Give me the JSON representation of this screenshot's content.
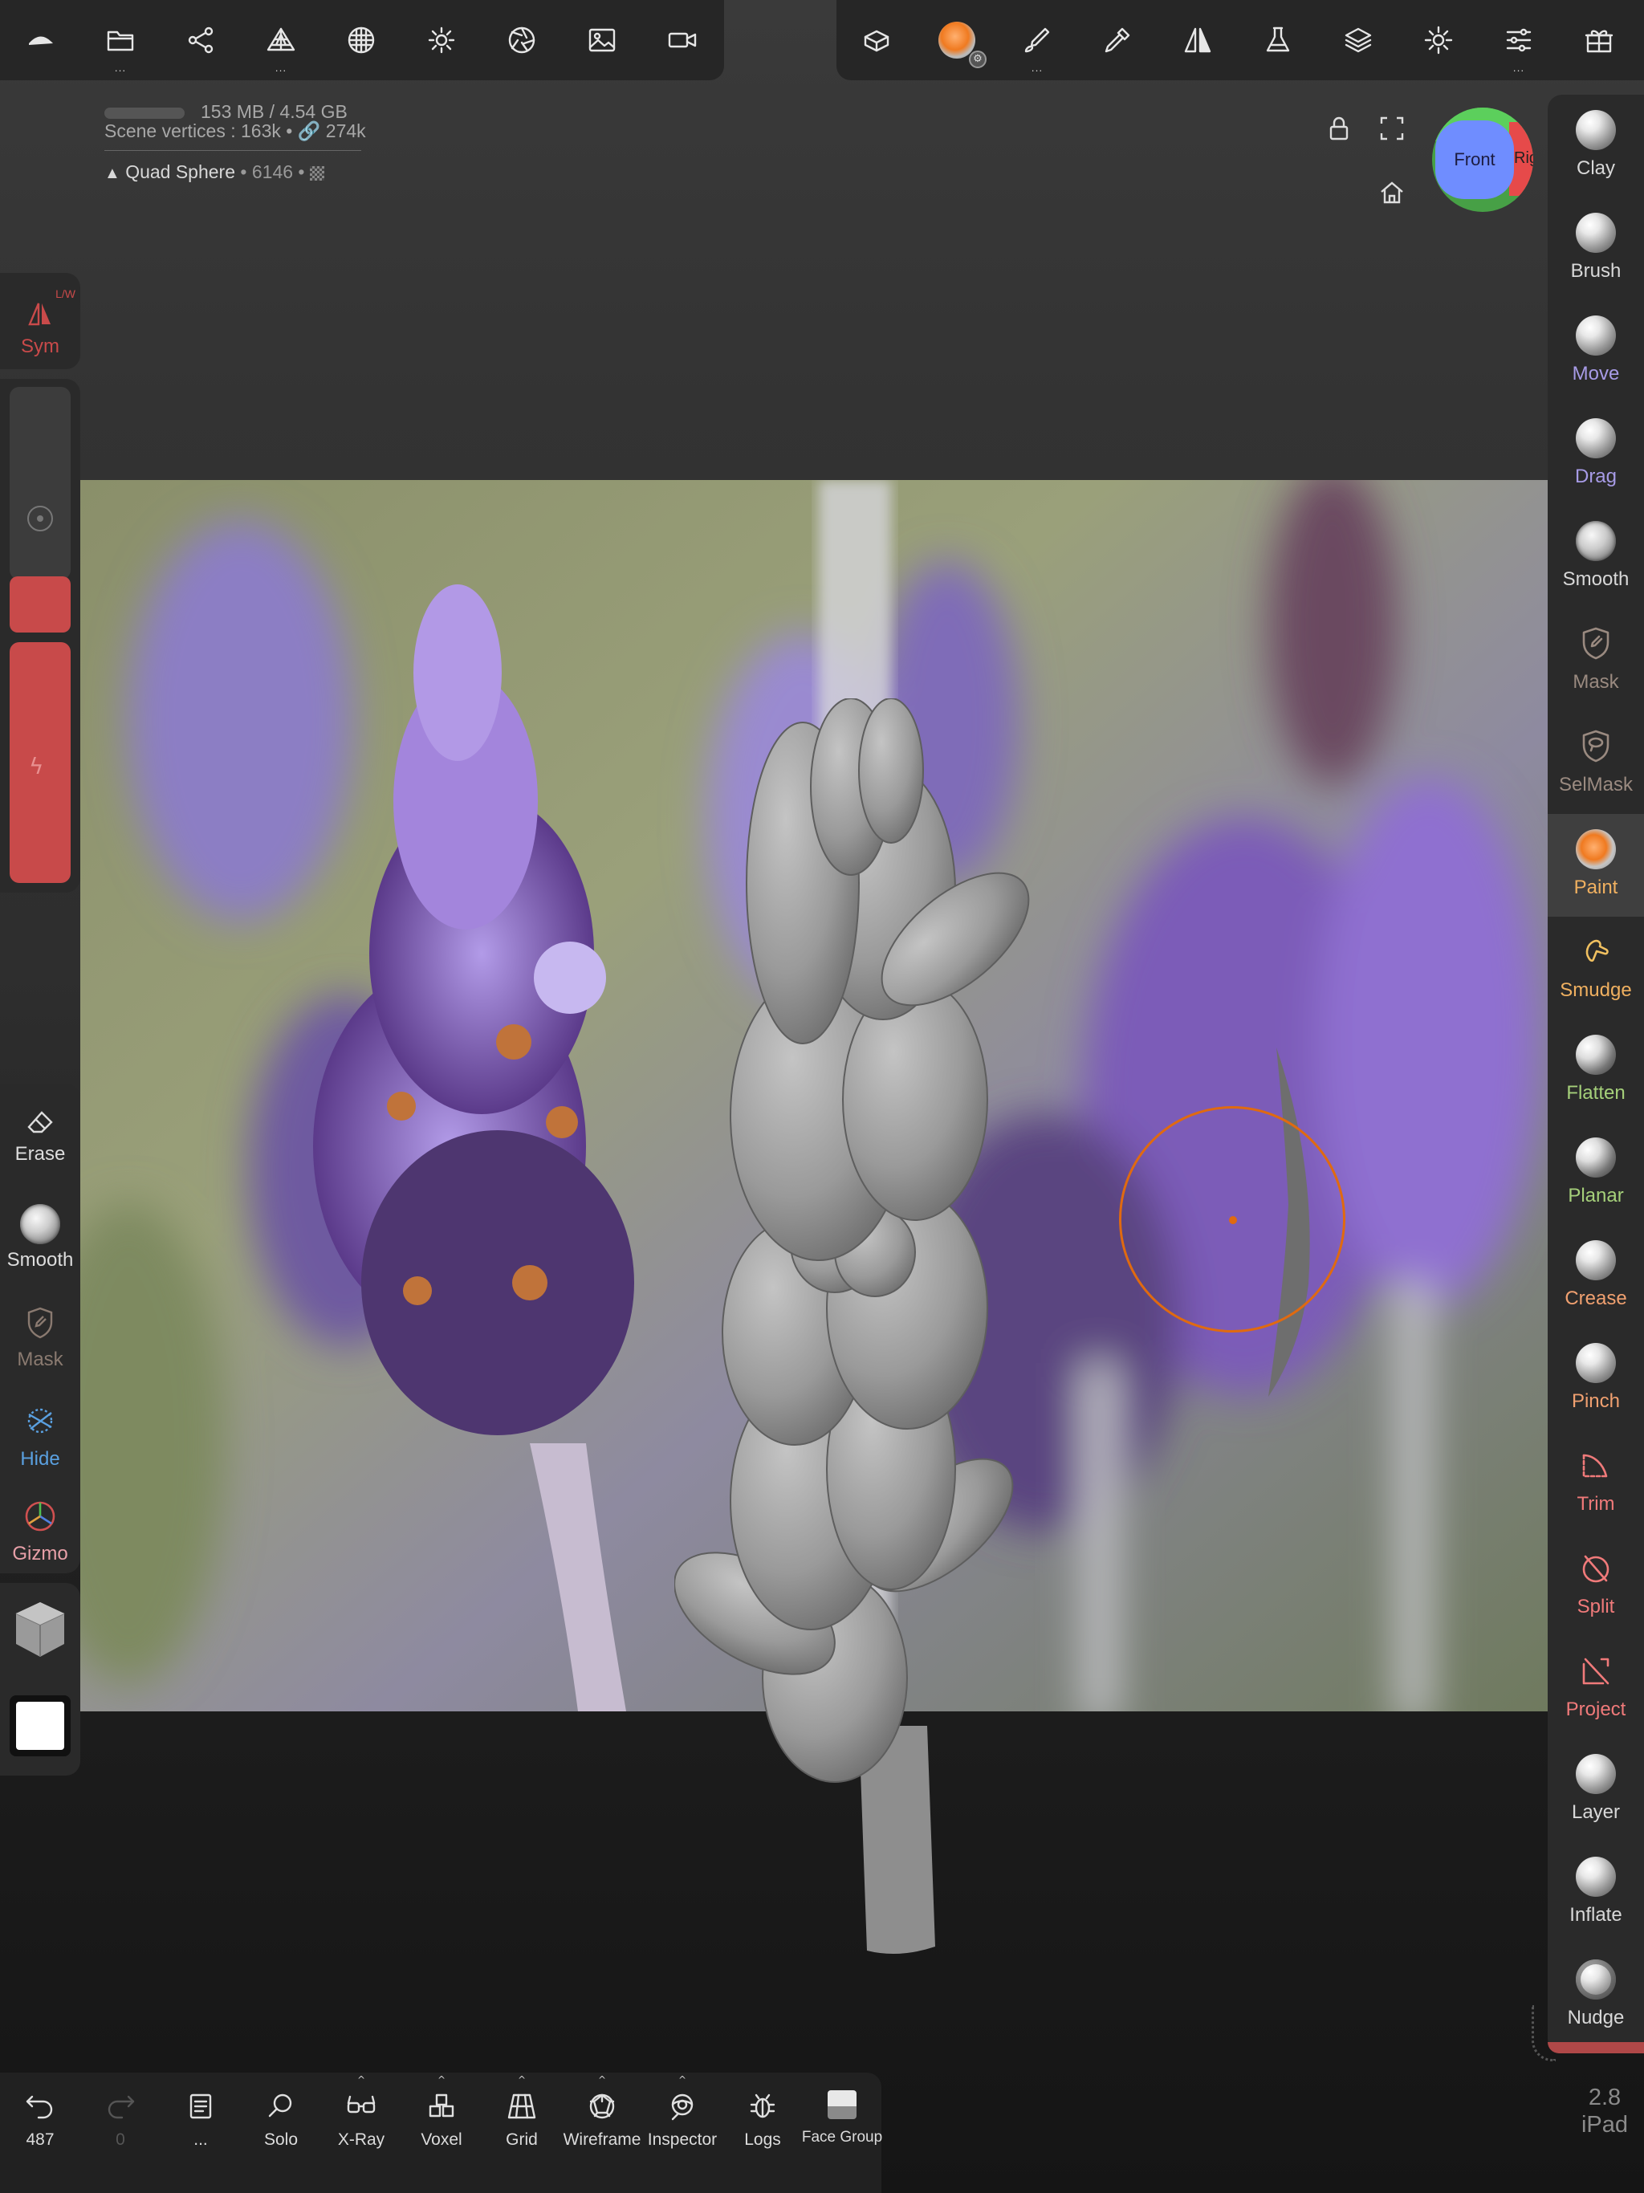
{
  "top_toolbar_left": [
    {
      "name": "logo-icon"
    },
    {
      "name": "folder-icon",
      "more": true
    },
    {
      "name": "scene-graph-icon"
    },
    {
      "name": "topology-icon",
      "more": true
    },
    {
      "name": "material-icon"
    },
    {
      "name": "light-icon"
    },
    {
      "name": "camera-aperture-icon"
    },
    {
      "name": "background-image-icon"
    },
    {
      "name": "video-camera-icon"
    }
  ],
  "top_toolbar_right": [
    {
      "name": "mesh-tools-icon"
    },
    {
      "name": "paint-material-icon"
    },
    {
      "name": "brush-stroke-icon",
      "more": true
    },
    {
      "name": "eyedropper-icon"
    },
    {
      "name": "symmetry-icon"
    },
    {
      "name": "flask-icon"
    },
    {
      "name": "layers-icon"
    },
    {
      "name": "settings-gear-icon"
    },
    {
      "name": "sliders-icon",
      "more": true
    },
    {
      "name": "gift-icon"
    }
  ],
  "info": {
    "memory": "153 MB / 4.54 GB",
    "scene_vertices": "Scene vertices : 163k",
    "link_count": "274k",
    "mesh_name": "Quad Sphere",
    "mesh_count": "6146"
  },
  "view_cube": {
    "front": "Front",
    "right": "Rig"
  },
  "right_tools": [
    {
      "label": "Clay",
      "color": "#d8d8d8",
      "icon": "sphere"
    },
    {
      "label": "Brush",
      "color": "#d8d8d8",
      "icon": "sphere"
    },
    {
      "label": "Move",
      "color": "#a79be6",
      "icon": "sphere"
    },
    {
      "label": "Drag",
      "color": "#a79be6",
      "icon": "sphere"
    },
    {
      "label": "Smooth",
      "color": "#d8d8d8",
      "icon": "rough"
    },
    {
      "label": "Mask",
      "color": "#9a8a80",
      "icon": "mask"
    },
    {
      "label": "SelMask",
      "color": "#9a8a80",
      "icon": "selmask"
    },
    {
      "label": "Paint",
      "color": "#f0b060",
      "icon": "orange"
    },
    {
      "label": "Smudge",
      "color": "#f0b060",
      "icon": "smudge"
    },
    {
      "label": "Flatten",
      "color": "#a5d07a",
      "icon": "dark"
    },
    {
      "label": "Planar",
      "color": "#a5d07a",
      "icon": "dark"
    },
    {
      "label": "Crease",
      "color": "#f0a070",
      "icon": "sphere"
    },
    {
      "label": "Pinch",
      "color": "#f0a070",
      "icon": "sphere"
    },
    {
      "label": "Trim",
      "color": "#f07a7a",
      "icon": "trim"
    },
    {
      "label": "Split",
      "color": "#f07a7a",
      "icon": "split"
    },
    {
      "label": "Project",
      "color": "#f07a7a",
      "icon": "project"
    },
    {
      "label": "Layer",
      "color": "#d8d8d8",
      "icon": "sphere"
    },
    {
      "label": "Inflate",
      "color": "#d8d8d8",
      "icon": "sphere"
    },
    {
      "label": "Nudge",
      "color": "#d8d8d8",
      "icon": "nudge"
    }
  ],
  "left_panel": {
    "sym_label": "Sym",
    "sym_mode": "L/W",
    "erase": "Erase",
    "smooth": "Smooth",
    "mask": "Mask",
    "hide": "Hide",
    "gizmo": "Gizmo"
  },
  "bottom_tools": [
    {
      "label": "487",
      "icon": "undo-icon"
    },
    {
      "label": "0",
      "icon": "redo-icon"
    },
    {
      "label": "...",
      "icon": "notebook-icon"
    },
    {
      "label": "Solo",
      "icon": "search-icon"
    },
    {
      "label": "X-Ray",
      "icon": "glasses-icon"
    },
    {
      "label": "Voxel",
      "icon": "voxel-icon"
    },
    {
      "label": "Grid",
      "icon": "grid-icon"
    },
    {
      "label": "Wireframe",
      "icon": "wireframe-icon"
    },
    {
      "label": "Inspector",
      "icon": "inspector-icon"
    },
    {
      "label": "Logs",
      "icon": "bug-icon"
    },
    {
      "label": "Face Group",
      "icon": "face-group-icon"
    }
  ],
  "version": {
    "number": "2.8",
    "device": "iPad"
  },
  "colors": {
    "accent_orange": "#e06a10",
    "sym_red": "#c94a4a",
    "panel": "#2a2a2a"
  }
}
